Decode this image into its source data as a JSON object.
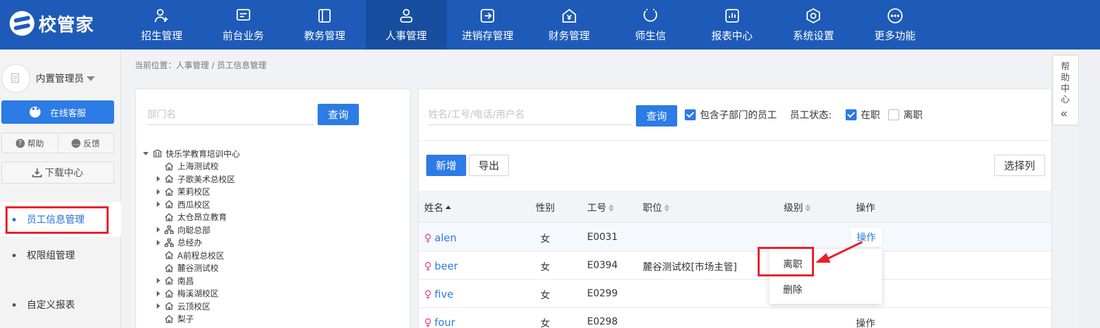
{
  "brand": {
    "logo_text": "校管家"
  },
  "nav": [
    {
      "label": "招生管理",
      "icon": "user-plus-icon"
    },
    {
      "label": "前台业务",
      "icon": "monitor-icon"
    },
    {
      "label": "教务管理",
      "icon": "book-icon"
    },
    {
      "label": "人事管理",
      "icon": "person-icon",
      "active": true
    },
    {
      "label": "进销存管理",
      "icon": "inventory-icon"
    },
    {
      "label": "财务管理",
      "icon": "yuan-house-icon"
    },
    {
      "label": "师生信",
      "icon": "chat-icon"
    },
    {
      "label": "报表中心",
      "icon": "chart-icon"
    },
    {
      "label": "系统设置",
      "icon": "settings-icon"
    },
    {
      "label": "更多功能",
      "icon": "more-icon"
    }
  ],
  "sidebar": {
    "user_name": "内置管理员",
    "online_service": "在线客服",
    "help": "帮助",
    "feedback": "反馈",
    "download": "下载中心",
    "menu": [
      {
        "label": "员工信息管理",
        "active": true
      },
      {
        "label": "权限组管理"
      },
      {
        "label": "自定义报表"
      }
    ]
  },
  "breadcrumb": "当前位置：人事管理 / 员工信息管理",
  "dept": {
    "placeholder": "部门名",
    "query": "查询",
    "tree": [
      {
        "label": "快乐学教育培训中心",
        "level": 0,
        "expander": "down",
        "icon": "bank-icon"
      },
      {
        "label": "上海测试校",
        "level": 1,
        "expander": "none",
        "icon": "home-icon"
      },
      {
        "label": "子歌美术总校区",
        "level": 1,
        "expander": "right",
        "icon": "home-icon"
      },
      {
        "label": "茉莉校区",
        "level": 1,
        "expander": "right",
        "icon": "home-icon"
      },
      {
        "label": "西瓜校区",
        "level": 1,
        "expander": "right",
        "icon": "home-icon"
      },
      {
        "label": "太仓昂立教育",
        "level": 1,
        "expander": "none",
        "icon": "home-icon"
      },
      {
        "label": "向聪总部",
        "level": 1,
        "expander": "right",
        "icon": "org-icon"
      },
      {
        "label": "总经办",
        "level": 1,
        "expander": "right",
        "icon": "org-icon"
      },
      {
        "label": "A前程总校区",
        "level": 1,
        "expander": "none",
        "icon": "home-icon"
      },
      {
        "label": "麓谷测试校",
        "level": 1,
        "expander": "none",
        "icon": "home-icon"
      },
      {
        "label": "南昌",
        "level": 1,
        "expander": "right",
        "icon": "home-icon"
      },
      {
        "label": "梅溪湖校区",
        "level": 1,
        "expander": "right",
        "icon": "home-icon"
      },
      {
        "label": "云顶校区",
        "level": 1,
        "expander": "right",
        "icon": "home-icon"
      },
      {
        "label": "梨子",
        "level": 1,
        "expander": "none",
        "icon": "home-icon"
      }
    ]
  },
  "employees": {
    "search_placeholder": "姓名/工号/电话/用户名",
    "query": "查询",
    "include_sub_label": "包含子部门的员工",
    "include_sub_checked": true,
    "status_label": "员工状态:",
    "status_on_label": "在职",
    "status_on_checked": true,
    "status_off_label": "离职",
    "status_off_checked": false,
    "add": "新增",
    "export": "导出",
    "select_columns": "选择列",
    "columns": [
      "姓名",
      "性别",
      "工号",
      "职位",
      "级别",
      "操作"
    ],
    "rows": [
      {
        "name": "alen",
        "gender_icon": "♀",
        "gender": "女",
        "id": "E0031",
        "position": "",
        "level": "",
        "op": "操作"
      },
      {
        "name": "beer",
        "gender_icon": "♀",
        "gender": "女",
        "id": "E0394",
        "position": "麓谷测试校[市场主管]",
        "level": "",
        "op": ""
      },
      {
        "name": "five",
        "gender_icon": "♀",
        "gender": "女",
        "id": "E0299",
        "position": "",
        "level": "",
        "op": ""
      },
      {
        "name": "four",
        "gender_icon": "♀",
        "gender": "女",
        "id": "E0298",
        "position": "",
        "level": "",
        "op": "操作"
      }
    ],
    "menu": {
      "resign": "离职",
      "delete": "删除"
    }
  },
  "help_side": {
    "text": "帮助中心",
    "collapse": "«"
  },
  "colors": {
    "primary": "#2d7be5",
    "nav_bg": "#1e5bb8",
    "annotation": "#e8202a"
  }
}
